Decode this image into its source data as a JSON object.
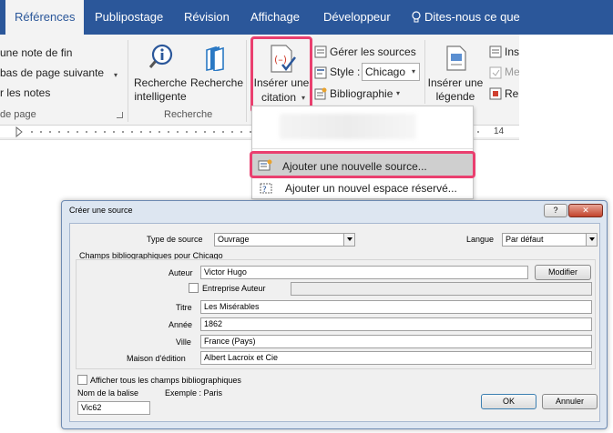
{
  "tabs": [
    {
      "label": "Références",
      "active": true
    },
    {
      "label": "Publipostage"
    },
    {
      "label": "Révision"
    },
    {
      "label": "Affichage"
    },
    {
      "label": "Développeur"
    }
  ],
  "tell_me": "Dites-nous ce que v",
  "ribbon": {
    "footnotes": {
      "line1": "une note de fin",
      "line2": "bas de page suivante",
      "line3": "r les notes",
      "group_label": "de page"
    },
    "research": {
      "smart_lookup_l1": "Recherche",
      "smart_lookup_l2": "intelligente",
      "researcher": "Recherche",
      "group_label": "Recherche"
    },
    "citations": {
      "insert_l1": "Insérer une",
      "insert_l2": "citation",
      "manage_sources": "Gérer les sources",
      "style_label": "Style :",
      "style_value": "Chicago",
      "bibliography": "Bibliographie"
    },
    "captions": {
      "insert_l1": "Insérer une",
      "insert_l2": "légende",
      "side1": "Ins",
      "side2": "Me",
      "side3": "Re"
    }
  },
  "ruler": {
    "mark": "14"
  },
  "menu": {
    "item1": "Ajouter une nouvelle source...",
    "item2": "Ajouter un nouvel espace réservé..."
  },
  "dialog": {
    "title": "Créer une source",
    "help": "?",
    "close": "✕",
    "source_type_label": "Type de source",
    "source_type_value": "Ouvrage",
    "language_label": "Langue",
    "language_value": "Par défaut",
    "fields_header": "Champs bibliographiques pour Chicago",
    "author_label": "Auteur",
    "author_value": "Victor Hugo",
    "modify_button": "Modifier",
    "corporate_label": "Entreprise Auteur",
    "title_label": "Titre",
    "title_value": "Les Misérables",
    "year_label": "Année",
    "year_value": "1862",
    "city_label": "Ville",
    "city_value": "France (Pays)",
    "publisher_label": "Maison d'édition",
    "publisher_value": "Albert Lacroix et Cie",
    "show_all_label": "Afficher tous les champs bibliographiques",
    "tag_label": "Nom de la balise",
    "tag_value": "Vic62",
    "example": "Exemple : Paris",
    "ok": "OK",
    "cancel": "Annuler"
  },
  "colors": {
    "accent": "#2b579a",
    "highlight": "#ea3f6f"
  }
}
